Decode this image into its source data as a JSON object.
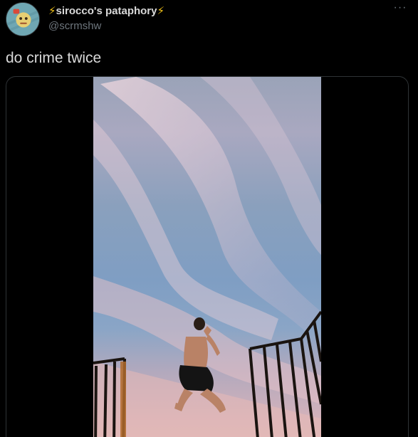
{
  "tweet": {
    "author": {
      "bolt_left": "⚡",
      "name": "sirocco's pataphory",
      "bolt_right": "⚡",
      "handle": "@scrmshw",
      "avatar_icon": "avatar-illustration"
    },
    "more_label": "···",
    "text": "do crime twice",
    "media": {
      "type": "video",
      "description_icon": "video-thumbnail"
    }
  },
  "colors": {
    "background": "#000000",
    "text": "#d9d9d9",
    "muted": "#6e767d",
    "border": "#2f3336",
    "bolt": "#f5c518"
  }
}
